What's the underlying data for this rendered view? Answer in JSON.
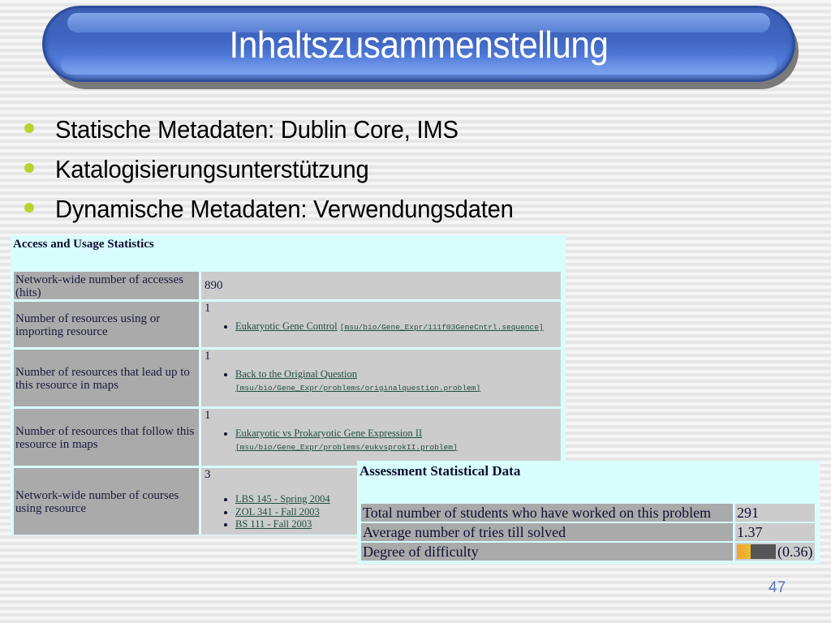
{
  "slide": {
    "title": "Inhaltszusammenstellung",
    "page_number": "47",
    "bullets": [
      "Statische Metadaten: Dublin Core, IMS",
      "Katalogisierungsunterstützung",
      "Dynamische Metadaten: Verwendungsdaten"
    ]
  },
  "access_panel": {
    "title": "Access and Usage Statistics",
    "rows": [
      {
        "label": "Network-wide number of accesses (hits)",
        "value": "890",
        "items": []
      },
      {
        "label": "Number of resources using or importing resource",
        "value": "1",
        "items": [
          {
            "link": "Eukaryotic Gene Control",
            "path": "[msu/bio/Gene_Expr/111f03GeneCntrl.sequence]"
          }
        ]
      },
      {
        "label": "Number of resources that lead up to this resource in maps",
        "value": "1",
        "items": [
          {
            "link": "Back to the Original Question",
            "path": "[msu/bio/Gene_Expr/problems/originalquestion.problem]"
          }
        ]
      },
      {
        "label": "Number of resources that follow this resource in maps",
        "value": "1",
        "items": [
          {
            "link": "Eukaryotic vs Prokaryotic Gene Expression II",
            "path": "[msu/bio/Gene_Expr/problems/eukvsprokII.problem]"
          }
        ]
      },
      {
        "label": "Network-wide number of courses using resource",
        "value": "3",
        "items": [
          {
            "link": "LBS 145 - Spring 2004"
          },
          {
            "link": "ZOL 341 - Fall 2003"
          },
          {
            "link": "BS 111 - Fall 2003"
          }
        ]
      }
    ]
  },
  "assessment_panel": {
    "title": "Assessment Statistical Data",
    "rows": [
      {
        "label": "Total number of students who have worked on this problem",
        "value": "291"
      },
      {
        "label": "Average number of tries till solved",
        "value": "1.37"
      },
      {
        "label": "Degree of difficulty",
        "value": "(0.36)",
        "difficulty_fraction": 0.36
      }
    ]
  },
  "colors": {
    "title_blue": "#3f66c2",
    "bullet_green": "#b8d22e",
    "panel_cyan": "#d8fdfd",
    "label_gray": "#aaaaaa",
    "value_gray": "#cccccc",
    "link_green": "#1f4f3f",
    "page_number_blue": "#5a78c0"
  }
}
